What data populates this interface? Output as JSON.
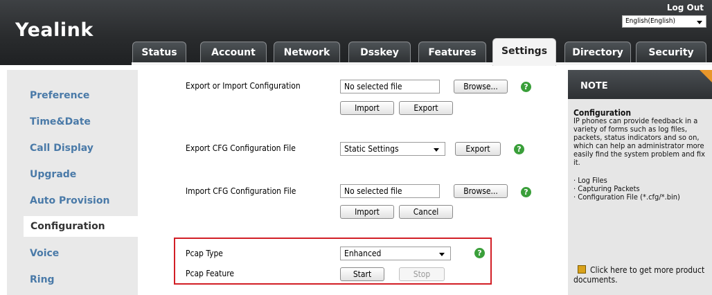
{
  "header": {
    "brand": "Yealink",
    "logout": "Log Out",
    "language": "English(English)",
    "tabs": [
      "Status",
      "Account",
      "Network",
      "Dsskey",
      "Features",
      "Settings",
      "Directory",
      "Security"
    ],
    "active_tab": "Settings"
  },
  "sidebar": {
    "items": [
      "Preference",
      "Time&Date",
      "Call Display",
      "Upgrade",
      "Auto Provision",
      "Configuration",
      "Voice",
      "Ring"
    ],
    "active": "Configuration"
  },
  "main": {
    "export_import": {
      "label": "Export or Import Configuration",
      "file": "No selected file",
      "browse": "Browse...",
      "import": "Import",
      "export": "Export"
    },
    "export_cfg": {
      "label": "Export CFG Configuration File",
      "select": "Static Settings",
      "export": "Export"
    },
    "import_cfg": {
      "label": "Import CFG Configuration File",
      "file": "No selected file",
      "browse": "Browse...",
      "import": "Import",
      "cancel": "Cancel"
    },
    "pcap_type": {
      "label": "Pcap Type",
      "select": "Enhanced"
    },
    "pcap_feature": {
      "label": "Pcap Feature",
      "start": "Start",
      "stop": "Stop"
    },
    "help": "?"
  },
  "note": {
    "title": "NOTE",
    "heading": "Configuration",
    "text": "IP phones can provide feedback in a variety of forms such as log files, packets, status indicators and so on, which can help an administrator more easily find the system problem and fix it.",
    "bullets": [
      "· Log Files",
      "· Capturing Packets",
      "· Configuration File (*.cfg/*.bin)"
    ],
    "doc_link": "Click here to get more product documents."
  },
  "colors": {
    "link_blue": "#4a7aa8",
    "help_green": "#3a9f3a",
    "highlight_red": "#d21e25",
    "note_corner": "#e8962a"
  }
}
